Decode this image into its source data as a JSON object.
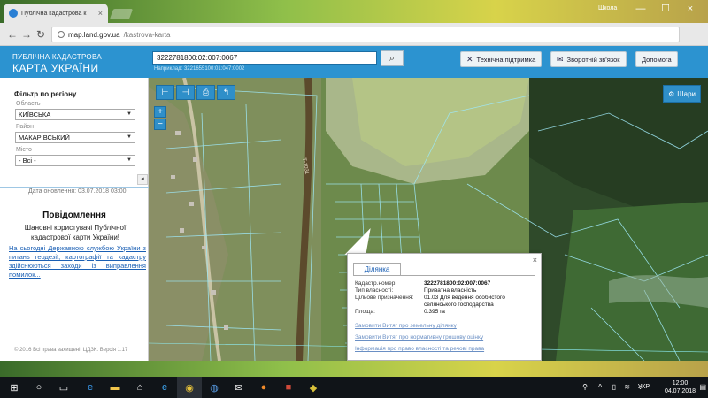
{
  "browser": {
    "tab_title": "Публічна кадастрова к",
    "tab_close": "×",
    "profile_name": "Школа",
    "win_min": "—",
    "win_max": "☐",
    "win_close": "×",
    "nav_back": "←",
    "nav_forward": "→",
    "nav_reload": "↻",
    "url_host": "map.land.gov.ua",
    "url_path": "/kastrova-karta",
    "star": "★",
    "menu": "⋮"
  },
  "header": {
    "logo_line1": "ПУБЛІЧНА КАДАСТРОВА",
    "logo_line2": "КАРТА УКРАЇНИ",
    "search_value": "3222781800:02:007:0067",
    "search_example": "Наприклад: 3221655100:01:047:0002",
    "buttons": {
      "support": "Технічна підтримка",
      "feedback": "Зворотній зв'язок",
      "help": "Допомога"
    }
  },
  "sidebar": {
    "filter_title": "Фільтр по регіону",
    "oblast_label": "Область",
    "oblast_value": "КИЇВСЬКА",
    "raion_label": "Район",
    "raion_value": "МАКАРІВСЬКИЙ",
    "misto_label": "Місто",
    "misto_value": "- Всі -",
    "collapse_glyph": "◂",
    "updated": "Дата оновлення: 03.07.2018 03:00",
    "notification_title": "Повідомлення",
    "notification_body": "Шановні користувачі Публічної кадастрової карти України!",
    "notification_link": "На сьогодні Державною службою України з питань геодезії, картографії та кадастру здійснюються заходи із виправлення помилок...",
    "copyright": "© 2016 Всі права захищені. ЦДЗК. Версія 1.17"
  },
  "map": {
    "layers_label": "Шари",
    "tools": [
      "⊢",
      "⊣",
      "⎙",
      "↰"
    ],
    "zoom_in": "+",
    "zoom_out": "−",
    "road_label": "Т-1031"
  },
  "popup": {
    "tab_label": "Ділянка",
    "close": "×",
    "fields": {
      "cadastral_label": "Кадастр.номер:",
      "cadastral_value": "3222781800:02:007:0067",
      "ownership_label": "Тип власності:",
      "ownership_value": "Приватна власність",
      "purpose_label": "Цільове призначення:",
      "purpose_value": "01.03 Для ведення особистого селянського господарства",
      "area_label": "Площа:",
      "area_value": "0.395 га"
    },
    "links": [
      "Замовити Витяг про земельну ділянку",
      "Замовити Витяг про нормативну грошову оцінку",
      "Інформація про право власності та речові права"
    ]
  },
  "taskbar": {
    "lang": "УКР",
    "time": "12:00",
    "date": "04.07.2018"
  }
}
